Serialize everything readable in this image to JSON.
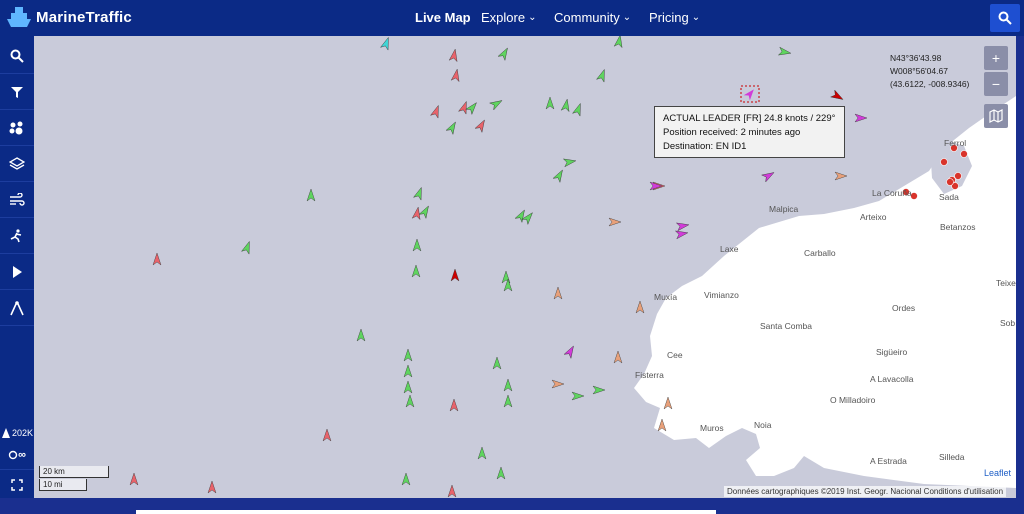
{
  "header": {
    "logo_text": "MarineTraffic",
    "nav": [
      {
        "label": "Live Map",
        "active": true,
        "dropdown": false
      },
      {
        "label": "Explore",
        "active": false,
        "dropdown": true
      },
      {
        "label": "Community",
        "active": false,
        "dropdown": true
      },
      {
        "label": "Pricing",
        "active": false,
        "dropdown": true
      }
    ],
    "search_icon": "search-icon"
  },
  "sidebar": {
    "items": [
      {
        "icon": "search-icon"
      },
      {
        "icon": "filter-icon"
      },
      {
        "icon": "layers-paw-icon"
      },
      {
        "icon": "stack-layers-icon"
      },
      {
        "icon": "wind-icon"
      },
      {
        "icon": "route-icon"
      },
      {
        "icon": "play-icon"
      },
      {
        "icon": "compass-measure-icon"
      }
    ],
    "vessel_count": "202K",
    "toggle_label": "∞"
  },
  "map": {
    "coords": {
      "lat": "N43°36'43.98",
      "lon": "W008°56'04.67",
      "decimal": "(43.6122, -008.9346)"
    },
    "zoom_in": "+",
    "zoom_out": "−",
    "tooltip": {
      "line1": "ACTUAL LEADER [FR] 24.8 knots / 229°",
      "line2": "Position received: 2 minutes ago",
      "line3": "Destination: EN ID1"
    },
    "places": [
      "Ferrol",
      "La Coruña",
      "Sada",
      "Malpica",
      "Arteixo",
      "Betanzos",
      "Laxe",
      "Carballo",
      "Muxía",
      "Vimianzo",
      "Ordes",
      "Santa Comba",
      "Cee",
      "Sigüeiro",
      "Fisterra",
      "A Lavacolla",
      "O Milladoiro",
      "Muros",
      "Noia",
      "A Estrada",
      "Silleda",
      "Teixe",
      "Sob"
    ],
    "scale": {
      "km": "20 km",
      "mi": "10 mi"
    },
    "leaflet": "Leaflet",
    "attribution": "Données cartographiques ©2019 Inst. Geogr. Nacional    Conditions d'utilisation",
    "colors": {
      "sea": "#c9cbda",
      "land": "#ffffff",
      "cargo": "#5fd45f",
      "tanker": "#e8636b",
      "passenger": "#3fd6d6",
      "pleasure": "#d13cd9",
      "fishing": "#e8a07a",
      "selected": "#cc0000"
    }
  }
}
